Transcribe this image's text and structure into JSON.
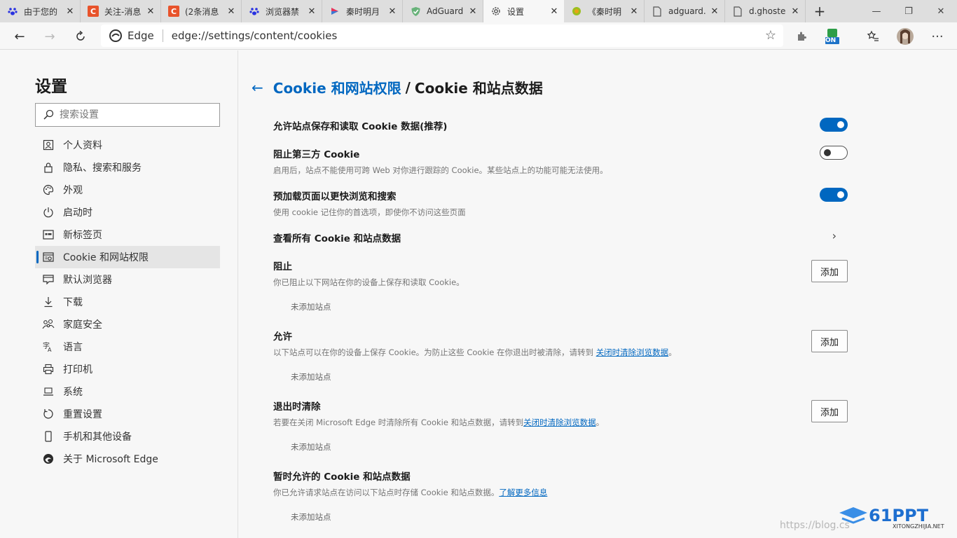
{
  "tabs": [
    {
      "title": "由于您的",
      "icon": "baidu-paw-icon",
      "color": "#2932e1"
    },
    {
      "title": "关注-消息",
      "icon": "csdn-c-icon",
      "color": "#e8532b"
    },
    {
      "title": "(2条消息",
      "icon": "csdn-c-icon",
      "color": "#e8532b"
    },
    {
      "title": "浏览器禁",
      "icon": "baidu-paw-icon",
      "color": "#2932e1"
    },
    {
      "title": "秦时明月",
      "icon": "video-app-icon",
      "color": "#e8325a"
    },
    {
      "title": "AdGuard",
      "icon": "adguard-shield-icon",
      "color": "#67b279"
    },
    {
      "title": "设置",
      "icon": "gear-icon",
      "color": "#444444"
    },
    {
      "title": "《秦时明",
      "icon": "site-circle-icon",
      "color": "#9bbf1f"
    },
    {
      "title": "adguard.",
      "icon": "page-icon",
      "color": "#555555"
    },
    {
      "title": "d.ghoste",
      "icon": "page-icon",
      "color": "#555555"
    }
  ],
  "toolbar": {
    "edge_label": "Edge",
    "url": "edge://settings/content/cookies",
    "ext_badge": "ON"
  },
  "sidebar": {
    "title": "设置",
    "search_placeholder": "搜索设置",
    "items": [
      {
        "label": "个人资料",
        "icon": "profile-icon"
      },
      {
        "label": "隐私、搜索和服务",
        "icon": "lock-icon"
      },
      {
        "label": "外观",
        "icon": "palette-icon"
      },
      {
        "label": "启动时",
        "icon": "power-icon"
      },
      {
        "label": "新标签页",
        "icon": "new-tab-page-icon"
      },
      {
        "label": "Cookie 和网站权限",
        "icon": "site-permissions-icon"
      },
      {
        "label": "默认浏览器",
        "icon": "default-browser-icon"
      },
      {
        "label": "下载",
        "icon": "download-icon"
      },
      {
        "label": "家庭安全",
        "icon": "family-icon"
      },
      {
        "label": "语言",
        "icon": "language-icon"
      },
      {
        "label": "打印机",
        "icon": "printer-icon"
      },
      {
        "label": "系统",
        "icon": "system-laptop-icon"
      },
      {
        "label": "重置设置",
        "icon": "reset-icon"
      },
      {
        "label": "手机和其他设备",
        "icon": "phone-icon"
      },
      {
        "label": "关于 Microsoft Edge",
        "icon": "edge-logo-icon"
      }
    ],
    "selected_index": 5
  },
  "main": {
    "breadcrumb_parent": "Cookie 和网站权限",
    "breadcrumb_sep": "/",
    "breadcrumb_current": "Cookie 和站点数据",
    "allow_cookies": {
      "title": "允许站点保存和读取 Cookie 数据(推荐)",
      "enabled": true
    },
    "block_third_party": {
      "title": "阻止第三方 Cookie",
      "desc": "启用后，站点不能使用可跨 Web 对你进行跟踪的 Cookie。某些站点上的功能可能无法使用。",
      "enabled": false
    },
    "preload": {
      "title": "预加载页面以更快浏览和搜索",
      "desc": "使用 cookie 记住你的首选项，即使你不访问这些页面",
      "enabled": true
    },
    "see_all": {
      "title": "查看所有 Cookie 和站点数据"
    },
    "block": {
      "title": "阻止",
      "desc": "你已阻止以下网站在你的设备上保存和读取 Cookie。",
      "add": "添加",
      "empty": "未添加站点"
    },
    "allow": {
      "title": "允许",
      "desc_pre": "以下站点可以在你的设备上保存 Cookie。为防止这些 Cookie 在你退出时被清除，请转到 ",
      "link": "关闭时清除浏览数据",
      "desc_post": "。",
      "add": "添加",
      "empty": "未添加站点"
    },
    "clear_on_exit": {
      "title": "退出时清除",
      "desc_pre": "若要在关闭 Microsoft Edge 时清除所有 Cookie 和站点数据，请转到",
      "link": "关闭时清除浏览数据",
      "desc_post": "。",
      "add": "添加",
      "empty": "未添加站点"
    },
    "temp_allowed": {
      "title": "暂时允许的 Cookie 和站点数据",
      "desc_pre": "你已允许请求站点在访问以下站点时存储 Cookie 和站点数据。",
      "link": "了解更多信息",
      "empty": "未添加站点"
    }
  },
  "watermark": {
    "blog": "https://blog.cs",
    "site": "XITONGZHIJIA.NET",
    "brand": "61PPT"
  },
  "colors": {
    "accent": "#0067c0",
    "tabstrip": "#dedede",
    "page_bg": "#f7f7f7"
  }
}
